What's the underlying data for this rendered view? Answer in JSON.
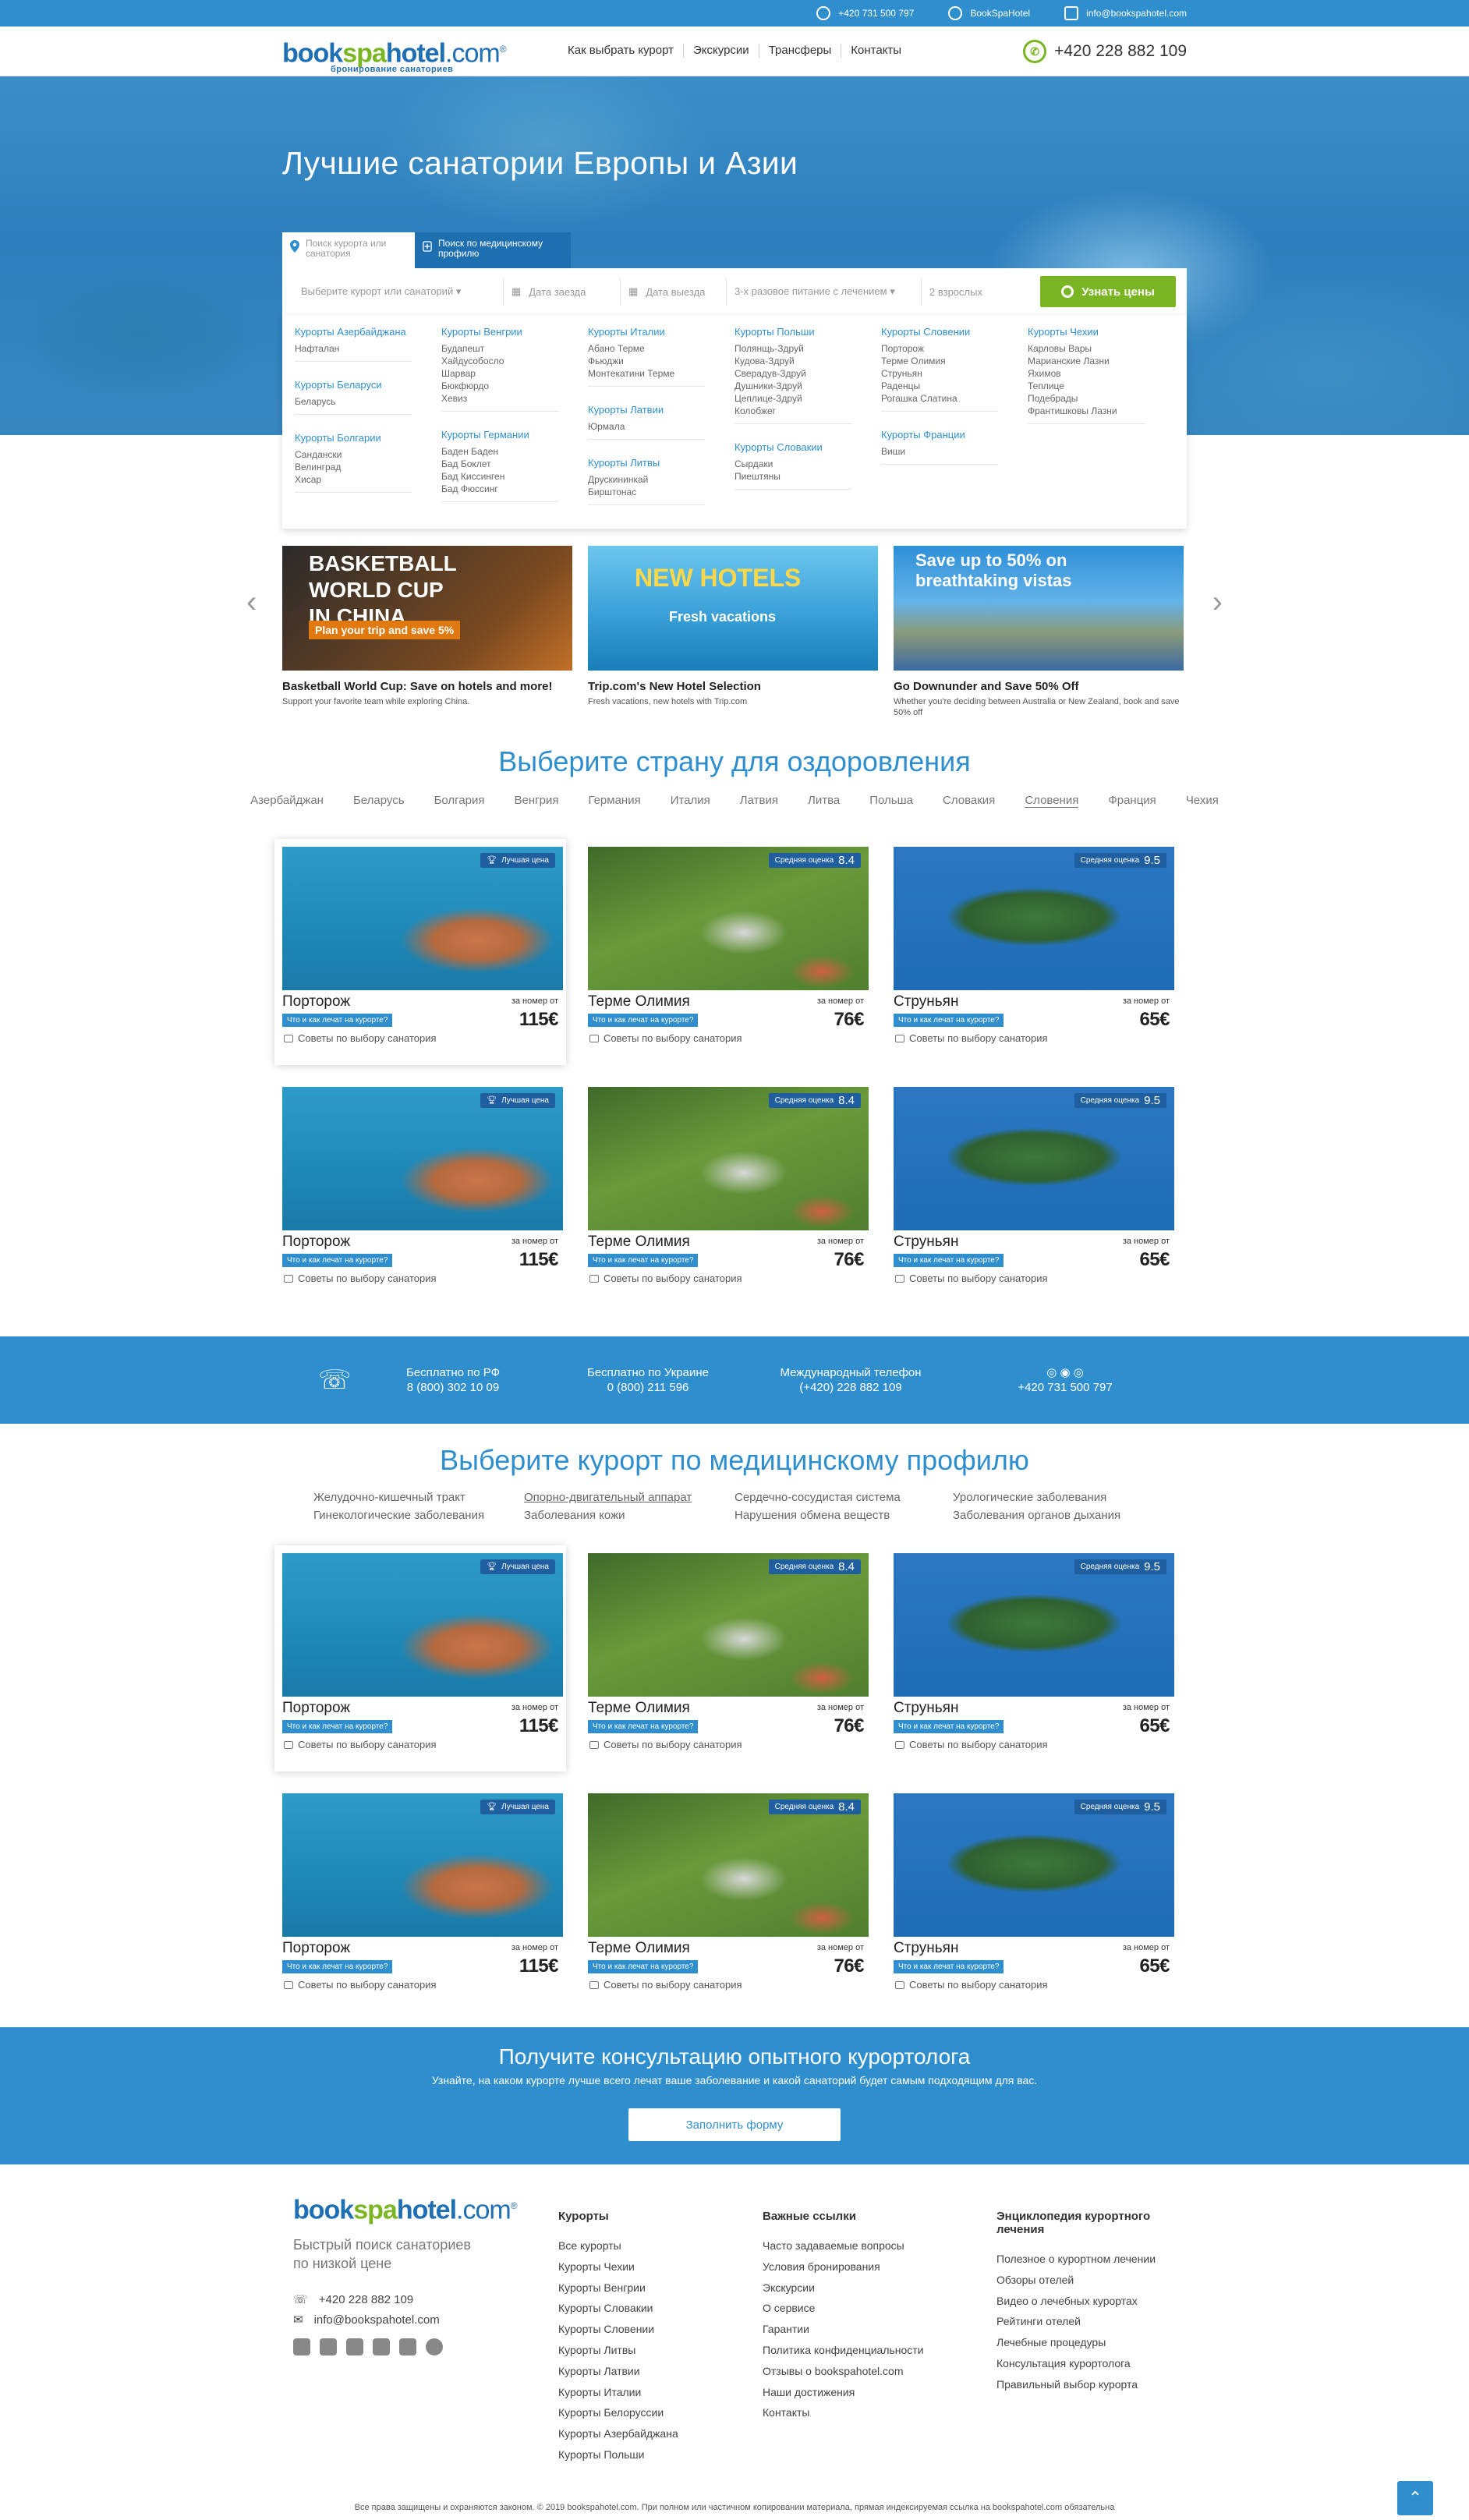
{
  "topbar": {
    "phone": "+420 731 500 797",
    "skype": "BookSpaHotel",
    "email": "info@bookspahotel.com"
  },
  "header": {
    "logo_a": "book",
    "logo_b": "spa",
    "logo_c": "hotel",
    "logo_d": ".com",
    "logo_reg": "®",
    "logo_sub": "бронирование санаториев",
    "nav": [
      "Как выбрать курорт",
      "Экскурсии",
      "Трансферы",
      "Контакты"
    ],
    "phone": "+420 228 882 109"
  },
  "hero": {
    "title": "Лучшие санатории Европы и Азии"
  },
  "search": {
    "tab1": "Поиск курорта или санатория",
    "tab2": "Поиск по медицинскому профилю",
    "field_resort": "Выберите курорт или санаторий ▾",
    "field_checkin": "Дата заезда",
    "field_checkout": "Дата выезда",
    "field_food": "3-х разовое питание с лечением ▾",
    "field_guests": "2 взрослых",
    "button": "Узнать цены"
  },
  "dropdown": [
    [
      {
        "title": "Курорты Азербайджана",
        "items": [
          "Нафталан"
        ]
      },
      {
        "title": "Курорты Беларуси",
        "items": [
          "Беларусь"
        ]
      },
      {
        "title": "Курорты Болгарии",
        "items": [
          "Сандански",
          "Велинград",
          "Хисар"
        ]
      }
    ],
    [
      {
        "title": "Курорты Венгрии",
        "items": [
          "Будапешт",
          "Хайдусобосло",
          "Шарвар",
          "Бюкфюрдо",
          "Хевиз"
        ]
      },
      {
        "title": "Курорты Германии",
        "items": [
          "Баден Баден",
          "Бад Боклет",
          "Бад Киссинген",
          "Бад Фюссинг"
        ]
      }
    ],
    [
      {
        "title": "Курорты Италии",
        "items": [
          "Абано Терме",
          "Фьюджи",
          "Монтекатини Терме"
        ]
      },
      {
        "title": "Курорты Латвии",
        "items": [
          "Юрмала"
        ]
      },
      {
        "title": "Курорты Литвы",
        "items": [
          "Друскининкай",
          "Бирштонас"
        ]
      }
    ],
    [
      {
        "title": "Курорты Польши",
        "items": [
          "Полянщь-Здруй",
          "Кудова-Здруй",
          "Сверадув-Здруй",
          "Душники-Здруй",
          "Цеплице-Здруй",
          "Колобжег"
        ]
      },
      {
        "title": "Курорты Словакии",
        "items": [
          "Сырдаки",
          "Пиештяны"
        ]
      }
    ],
    [
      {
        "title": "Курорты Словении",
        "items": [
          "Порторож",
          "Терме Олимия",
          "Струньян",
          "Раденцы",
          "Рогашка Слатина"
        ]
      },
      {
        "title": "Курорты Франции",
        "items": [
          "Виши"
        ]
      }
    ],
    [
      {
        "title": "Курорты Чехии",
        "items": [
          "Карловы Вары",
          "Марианские Лазни",
          "Яхимов",
          "Теплице",
          "Подебрады",
          "Франтишковы Лазни"
        ]
      }
    ]
  ],
  "promos": [
    {
      "overlay": "BASKETBALL WORLD CUP IN CHINA",
      "badge": "Plan your trip and save 5%",
      "title": "Basketball World Cup: Save on hotels and more!",
      "desc": "Support your favorite team while exploring China."
    },
    {
      "overlay": "NEW HOTELS",
      "badge": "Fresh vacations",
      "title": "Trip.com's New Hotel Selection",
      "desc": "Fresh vacations, new hotels with Trip.com"
    },
    {
      "overlay": "Save up to 50% on breathtaking vistas",
      "badge": "",
      "title": "Go Downunder and Save 50% Off",
      "desc": "Whether you're deciding between Australia or New Zealand, book and save 50% off"
    }
  ],
  "countries_section": {
    "title": "Выберите страну для оздоровления",
    "countries": [
      "Азербайджан",
      "Беларусь",
      "Болгария",
      "Венгрия",
      "Германия",
      "Италия",
      "Латвия",
      "Литва",
      "Польша",
      "Словакия",
      "Словения",
      "Франция",
      "Чехия"
    ],
    "active": "Словения"
  },
  "cards": [
    {
      "name": "Порторож",
      "label": "Лучшая цена",
      "score": "",
      "from": "за номер от",
      "tag": "Что и как лечат на курорте?",
      "price": "115€",
      "tips": "Советы по выбору санатория"
    },
    {
      "name": "Терме Олимия",
      "label": "Средняя оценка",
      "score": "8.4",
      "from": "за номер от",
      "tag": "Что и как лечат на курорте?",
      "price": "76€",
      "tips": "Советы по выбору санатория"
    },
    {
      "name": "Струньян",
      "label": "Средняя оценка",
      "score": "9.5",
      "from": "за номер от",
      "tag": "Что и как лечат на курорте?",
      "price": "65€",
      "tips": "Советы по выбору санатория"
    }
  ],
  "band": {
    "c1_title": "Бесплатно по РФ",
    "c1_phone": "8 (800) 302 10 09",
    "c2_title": "Бесплатно по Украине",
    "c2_phone": "0 (800) 211 596",
    "c3_title": "Международный телефон",
    "c3_phone": "(+420) 228 882 109",
    "c4_phone": "+420 731 500 797"
  },
  "profiles_section": {
    "title": "Выберите курорт по медицинскому профилю",
    "items": [
      "Желудочно-кишечный тракт",
      "Опорно-двигательный аппарат",
      "Сердечно-сосудистая система",
      "Урологические заболевания",
      "Гинекологические заболевания",
      "Заболевания кожи",
      "Нарушения обмена веществ",
      "Заболевания органов дыхания"
    ]
  },
  "consult": {
    "title": "Получите консультацию опытного курортолога",
    "text": "Узнайте, на каком курорте лучше всего лечат  ваше заболевание и какой санаторий будет самым подходящим для вас.",
    "button": "Заполнить форму"
  },
  "footer": {
    "desc": "Быстрый поиск санаториев по низкой цене",
    "phone": "+420 228 882 109",
    "email": "info@bookspahotel.com",
    "col1_title": "Курорты",
    "col1": [
      "Все курорты",
      "Курорты Чехии",
      "Курорты Венгрии",
      "Курорты Словакии",
      "Курорты Словении",
      "Курорты Литвы",
      "Курорты Латвии",
      "Курорты Италии",
      "Курорты Белоруссии",
      "Курорты Азербайджана",
      "Курорты Польши"
    ],
    "col2_title": "Важные ссылки",
    "col2": [
      "Часто задаваемые вопросы",
      "Условия бронирования",
      "Экскурсии",
      "О сервисе",
      "Гарантии",
      "Политика конфиденциальности",
      "Отзывы о bookspahotel.com",
      "Наши достижения",
      "Контакты"
    ],
    "col3_title": "Энциклопедия курортного лечения",
    "col3": [
      "Полезное о курортном лечении",
      "Обзоры отелей",
      "Видео о лечебных курортах",
      "Рейтинги отелей",
      "Лечебные процедуры",
      "Консультация курортолога",
      "Правильный выбор курорта"
    ],
    "copyright": "Все права защищены и охраняются законом. © 2019 bookspahotel.com. При полном или частичном копировании материала, прямая индексируемая ссылка на bookspahotel.com обязательна"
  }
}
